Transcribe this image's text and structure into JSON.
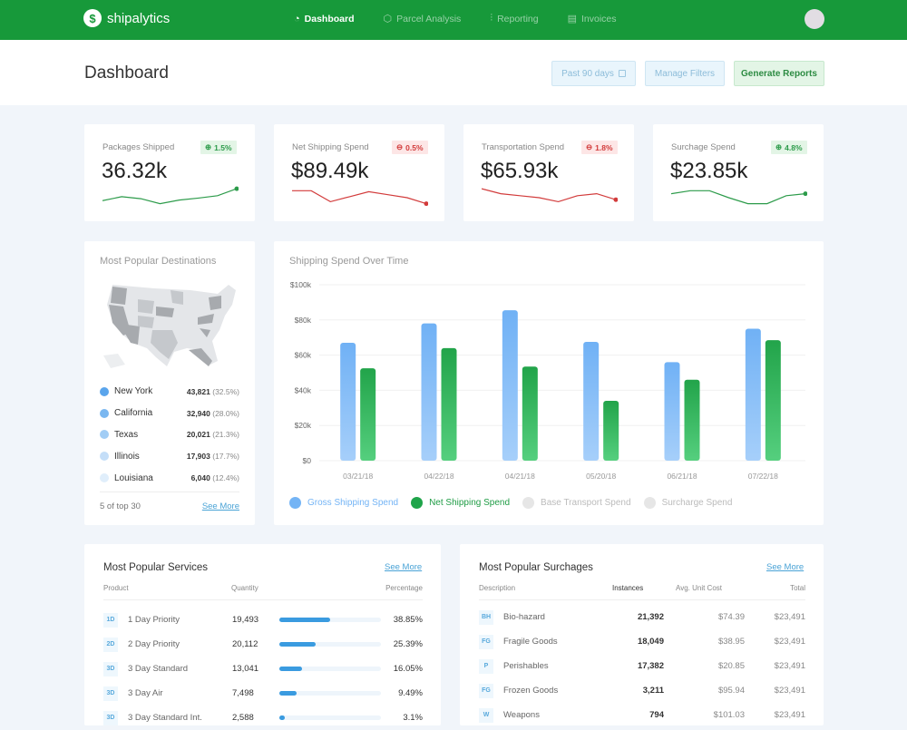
{
  "app": {
    "name": "shipalytics",
    "logo_icon": "dollar-ship-logo-icon"
  },
  "nav": [
    {
      "label": "Dashboard",
      "icon": "pie-chart-icon",
      "glyph": "◔",
      "active": true
    },
    {
      "label": "Parcel Analysis",
      "icon": "box-icon",
      "glyph": "⬡",
      "active": false
    },
    {
      "label": "Reporting",
      "icon": "bar-chart-icon",
      "glyph": "⫶",
      "active": false
    },
    {
      "label": "Invoices",
      "icon": "document-icon",
      "glyph": "▤",
      "active": false
    }
  ],
  "header": {
    "title": "Dashboard",
    "range_label": "Past 90 days",
    "range_icon": "calendar-icon",
    "filters_label": "Manage Filters",
    "generate_label": "Generate Reports"
  },
  "colors": {
    "brand": "#17993a",
    "up": "#2c9b4a",
    "down": "#d23b3b",
    "gross": "#74b4f5",
    "net": "#1fa44a"
  },
  "kpis": [
    {
      "label": "Packages Shipped",
      "value": "36.32k",
      "change": "1.5%",
      "direction": "up",
      "trend": [
        0.35,
        0.55,
        0.45,
        0.2,
        0.38,
        0.48,
        0.6,
        0.95
      ]
    },
    {
      "label": "Net Shipping Spend",
      "value": "$89.49k",
      "change": "0.5%",
      "direction": "down",
      "trend": [
        0.85,
        0.85,
        0.3,
        0.55,
        0.8,
        0.65,
        0.5,
        0.2
      ]
    },
    {
      "label": "Transportation Spend",
      "value": "$65.93k",
      "change": "1.8%",
      "direction": "down",
      "trend": [
        0.95,
        0.7,
        0.6,
        0.5,
        0.3,
        0.6,
        0.7,
        0.4
      ]
    },
    {
      "label": "Surchage Spend",
      "value": "$23.85k",
      "change": "4.8%",
      "direction": "up",
      "trend": [
        0.7,
        0.85,
        0.85,
        0.5,
        0.2,
        0.2,
        0.6,
        0.7
      ]
    }
  ],
  "destinations": {
    "title": "Most Popular Destinations",
    "items": [
      {
        "name": "New York",
        "count": "43,821",
        "pct": "(32.5%)",
        "color": "#5aa5ec"
      },
      {
        "name": "California",
        "count": "32,940",
        "pct": "(28.0%)",
        "color": "#7ab7f0"
      },
      {
        "name": "Texas",
        "count": "20,021",
        "pct": "(21.3%)",
        "color": "#a2cdf5"
      },
      {
        "name": "Illinois",
        "count": "17,903",
        "pct": "(17.7%)",
        "color": "#c4def8"
      },
      {
        "name": "Louisiana",
        "count": "6,040",
        "pct": "(12.4%)",
        "color": "#e0eefb"
      }
    ],
    "footer_count": "5 of top 30",
    "see_more": "See More"
  },
  "chart_data": {
    "type": "bar",
    "title": "Shipping Spend Over Time",
    "xlabel": "",
    "ylabel": "",
    "categories": [
      "03/21/18",
      "04/22/18",
      "04/21/18",
      "05/20/18",
      "06/21/18",
      "07/22/18"
    ],
    "yticks": [
      "$0",
      "$20k",
      "$40k",
      "$60k",
      "$80k",
      "$100k"
    ],
    "ylim": [
      0,
      100
    ],
    "units": "thousands USD",
    "grid": true,
    "legend_position": "bottom-left",
    "series": [
      {
        "name": "Gross Shipping Spend",
        "values": [
          67,
          78,
          85.5,
          67.5,
          56,
          75
        ],
        "color": "#74b4f5",
        "active": true
      },
      {
        "name": "Net Shipping Spend",
        "values": [
          52.5,
          64,
          53.5,
          34,
          46,
          68.5
        ],
        "color": "#1fa44a",
        "active": true
      },
      {
        "name": "Base Transport Spend",
        "values": [],
        "color": "#e6e6e6",
        "active": false
      },
      {
        "name": "Surcharge Spend",
        "values": [],
        "color": "#e6e6e6",
        "active": false
      }
    ]
  },
  "services": {
    "title": "Most Popular Services",
    "see_more": "See More",
    "headers": {
      "product": "Product",
      "quantity": "Quantity",
      "percentage": "Percentage"
    },
    "rows": [
      {
        "code": "1D",
        "name": "1 Day Priority",
        "qty": "19,493",
        "pct": "38.85%",
        "fraction": 0.5
      },
      {
        "code": "2D",
        "name": "2 Day Priority",
        "qty": "20,112",
        "pct": "25.39%",
        "fraction": 0.36
      },
      {
        "code": "3D",
        "name": "3 Day Standard",
        "qty": "13,041",
        "pct": "16.05%",
        "fraction": 0.22
      },
      {
        "code": "3D",
        "name": "3 Day Air",
        "qty": "7,498",
        "pct": "9.49%",
        "fraction": 0.17
      },
      {
        "code": "3D",
        "name": "3 Day Standard Int.",
        "qty": "2,588",
        "pct": "3.1%",
        "fraction": 0.05
      }
    ]
  },
  "surcharges": {
    "title": "Most Popular Surchages",
    "see_more": "See More",
    "headers": {
      "description": "Description",
      "instances": "Instances",
      "avg": "Avg. Unit Cost",
      "total": "Total"
    },
    "rows": [
      {
        "code": "BH",
        "name": "Bio-hazard",
        "instances": "21,392",
        "avg": "$74.39",
        "total": "$23,491"
      },
      {
        "code": "FG",
        "name": "Fragile Goods",
        "instances": "18,049",
        "avg": "$38.95",
        "total": "$23,491"
      },
      {
        "code": "P",
        "name": "Perishables",
        "instances": "17,382",
        "avg": "$20.85",
        "total": "$23,491"
      },
      {
        "code": "FG",
        "name": "Frozen Goods",
        "instances": "3,211",
        "avg": "$95.94",
        "total": "$23,491"
      },
      {
        "code": "W",
        "name": "Weapons",
        "instances": "794",
        "avg": "$101.03",
        "total": "$23,491"
      }
    ]
  }
}
